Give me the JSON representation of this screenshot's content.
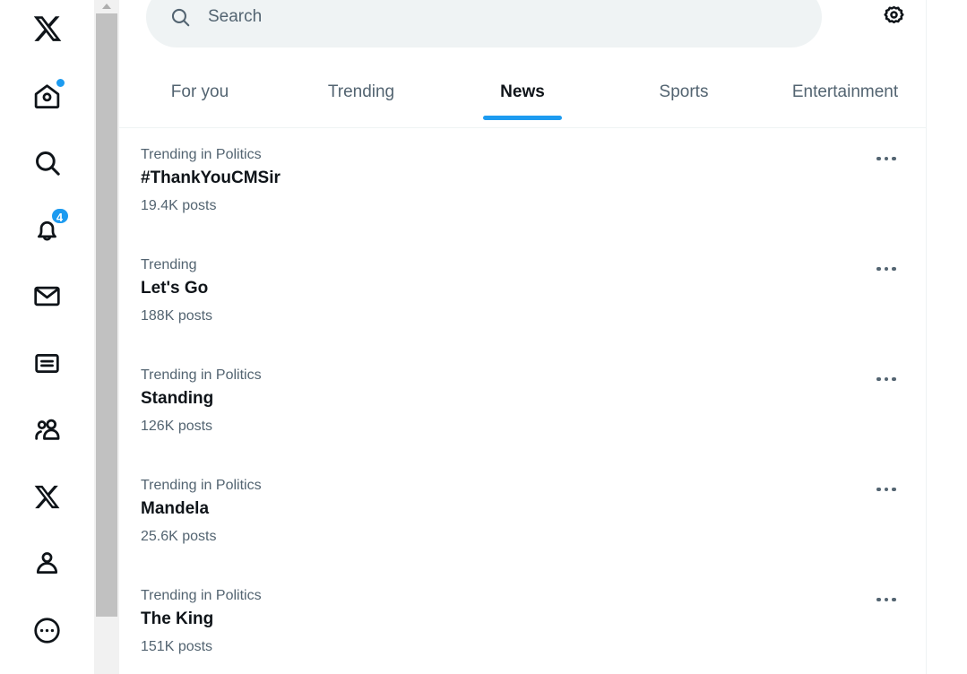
{
  "app": {
    "name": "X",
    "accent_color": "#1d9bf0",
    "text_primary": "#0f1419",
    "text_secondary": "#536471",
    "surface_muted": "#eff3f4"
  },
  "sidebar": {
    "items": [
      {
        "name": "x-logo",
        "label": "X",
        "icon": "x-logo-icon",
        "badge": null
      },
      {
        "name": "home",
        "label": "Home",
        "icon": "home-icon",
        "badge": "dot"
      },
      {
        "name": "explore",
        "label": "Explore",
        "icon": "search-icon",
        "badge": null
      },
      {
        "name": "notifications",
        "label": "Notifications",
        "icon": "bell-icon",
        "badge": "4"
      },
      {
        "name": "messages",
        "label": "Messages",
        "icon": "envelope-icon",
        "badge": null
      },
      {
        "name": "grok",
        "label": "Grok",
        "icon": "list-card-icon",
        "badge": null
      },
      {
        "name": "communities",
        "label": "Communities",
        "icon": "people-icon",
        "badge": null
      },
      {
        "name": "premium",
        "label": "Premium",
        "icon": "x-logo-icon",
        "badge": null
      },
      {
        "name": "profile",
        "label": "Profile",
        "icon": "person-icon",
        "badge": null
      },
      {
        "name": "more",
        "label": "More",
        "icon": "more-circle-icon",
        "badge": null
      }
    ]
  },
  "scrollbar": {
    "up_arrow": "scroll-up-arrow-icon",
    "orientation": "vertical"
  },
  "header": {
    "search": {
      "placeholder": "Search",
      "value": "",
      "icon": "search-icon"
    },
    "settings": {
      "icon": "gear-icon",
      "label": "Settings"
    }
  },
  "tabs": {
    "active_index": 2,
    "items": [
      {
        "label": "For you"
      },
      {
        "label": "Trending"
      },
      {
        "label": "News"
      },
      {
        "label": "Sports"
      },
      {
        "label": "Entertainment"
      }
    ]
  },
  "trends": {
    "more_icon": "more-horizontal-icon",
    "items": [
      {
        "category": "Trending in Politics",
        "name": "#ThankYouCMSir",
        "count": "19.4K posts"
      },
      {
        "category": "Trending",
        "name": "Let's Go",
        "count": "188K posts"
      },
      {
        "category": "Trending in Politics",
        "name": "Standing",
        "count": "126K posts"
      },
      {
        "category": "Trending in Politics",
        "name": "Mandela",
        "count": "25.6K posts"
      },
      {
        "category": "Trending in Politics",
        "name": "The King",
        "count": "151K posts"
      }
    ]
  }
}
